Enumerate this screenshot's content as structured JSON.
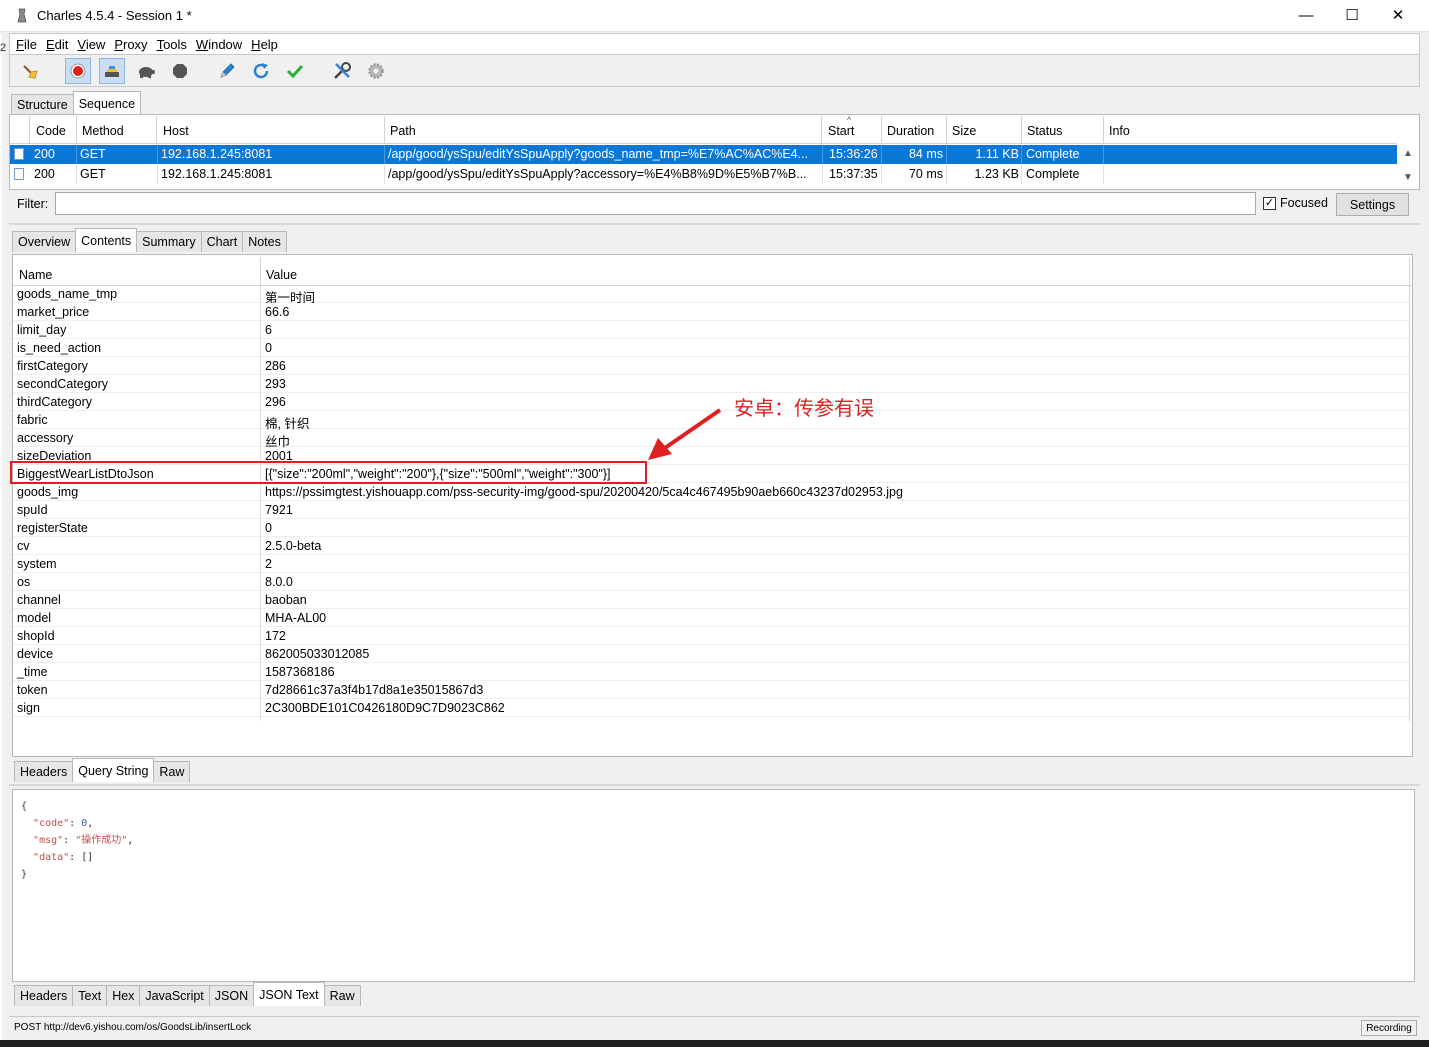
{
  "window": {
    "title": "Charles 4.5.4 - Session 1 *",
    "minimize": "—",
    "maximize": "☐",
    "close": "✕"
  },
  "edge_char": "2",
  "menu": [
    {
      "key": "F",
      "rest": "ile"
    },
    {
      "key": "E",
      "rest": "dit"
    },
    {
      "key": "V",
      "rest": "iew"
    },
    {
      "key": "P",
      "rest": "roxy"
    },
    {
      "key": "T",
      "rest": "ools"
    },
    {
      "key": "W",
      "rest": "indow"
    },
    {
      "key": "H",
      "rest": "elp"
    }
  ],
  "toolbar": {
    "icons": [
      "broom-icon",
      "record-icon",
      "throttle-icon",
      "turtle-icon",
      "stop-icon",
      "pen-icon",
      "refresh-icon",
      "check-icon",
      "tools-icon",
      "gear-icon"
    ],
    "record_color": "#e02020"
  },
  "view_tabs": {
    "structure": "Structure",
    "sequence": "Sequence"
  },
  "sequence": {
    "columns": {
      "code": "Code",
      "method": "Method",
      "host": "Host",
      "path": "Path",
      "start": "Start",
      "duration": "Duration",
      "size": "Size",
      "status": "Status",
      "info": "Info"
    },
    "sort_indicator": "^",
    "rows": [
      {
        "code": "200",
        "method": "GET",
        "host": "192.168.1.245:8081",
        "path": "/app/good/ysSpu/editYsSpuApply?goods_name_tmp=%E7%AC%AC%E4...",
        "start": "15:36:26",
        "duration": "84 ms",
        "size": "1.11 KB",
        "status": "Complete",
        "info": ""
      },
      {
        "code": "200",
        "method": "GET",
        "host": "192.168.1.245:8081",
        "path": "/app/good/ysSpu/editYsSpuApply?accessory=%E4%B8%9D%E5%B7%B...",
        "start": "15:37:35",
        "duration": "70 ms",
        "size": "1.23 KB",
        "status": "Complete",
        "info": ""
      }
    ],
    "scroll_up": "▲",
    "scroll_down": "▼"
  },
  "filter": {
    "label": "Filter:",
    "value": "",
    "focused_label": "Focused",
    "focused_checked": "✓",
    "settings_label": "Settings"
  },
  "detail_tabs": {
    "overview": "Overview",
    "contents": "Contents",
    "summary": "Summary",
    "chart": "Chart",
    "notes": "Notes"
  },
  "contents": {
    "columns": {
      "name": "Name",
      "value": "Value"
    },
    "rows": [
      {
        "name": "goods_name_tmp",
        "value": "第一时间"
      },
      {
        "name": "market_price",
        "value": "66.6"
      },
      {
        "name": "limit_day",
        "value": "6"
      },
      {
        "name": "is_need_action",
        "value": "0"
      },
      {
        "name": "firstCategory",
        "value": "286"
      },
      {
        "name": "secondCategory",
        "value": "293"
      },
      {
        "name": "thirdCategory",
        "value": "296"
      },
      {
        "name": "fabric",
        "value": "棉, 针织"
      },
      {
        "name": "accessory",
        "value": "丝巾"
      },
      {
        "name": "sizeDeviation",
        "value": "2001"
      },
      {
        "name": "BiggestWearListDtoJson",
        "value": "[{\"size\":\"200ml\",\"weight\":\"200\"},{\"size\":\"500ml\",\"weight\":\"300\"}]"
      },
      {
        "name": "goods_img",
        "value": "https://pssimgtest.yishouapp.com/pss-security-img/good-spu/20200420/5ca4c467495b90aeb660c43237d02953.jpg"
      },
      {
        "name": "spuId",
        "value": "7921"
      },
      {
        "name": "registerState",
        "value": "0"
      },
      {
        "name": "cv",
        "value": "2.5.0-beta"
      },
      {
        "name": "system",
        "value": "2"
      },
      {
        "name": "os",
        "value": "8.0.0"
      },
      {
        "name": "channel",
        "value": "baoban"
      },
      {
        "name": "model",
        "value": "MHA-AL00"
      },
      {
        "name": "shopId",
        "value": "172"
      },
      {
        "name": "device",
        "value": "862005033012085"
      },
      {
        "name": "_time",
        "value": "1587368186"
      },
      {
        "name": "token",
        "value": "7d28661c37a3f4b17d8a1e35015867d3"
      },
      {
        "name": "sign",
        "value": "2C300BDE101C0426180D9C7D9023C862"
      }
    ]
  },
  "request_tabs": {
    "headers": "Headers",
    "query_string": "Query String",
    "raw": "Raw"
  },
  "annotation": {
    "text": "安卓：传参有误",
    "color": "#e02020"
  },
  "response": {
    "open": "{",
    "code_key": "\"code\"",
    "code_val": "0",
    "msg_key": "\"msg\"",
    "msg_val": "\"操作成功\"",
    "data_key": "\"data\"",
    "data_val": "[]",
    "close": "}"
  },
  "response_tabs": {
    "headers": "Headers",
    "text": "Text",
    "hex": "Hex",
    "javascript": "JavaScript",
    "json": "JSON",
    "json_text": "JSON Text",
    "raw": "Raw"
  },
  "status": {
    "text": "POST http://dev6.yishou.com/os/GoodsLib/insertLock",
    "recording": "Recording"
  }
}
